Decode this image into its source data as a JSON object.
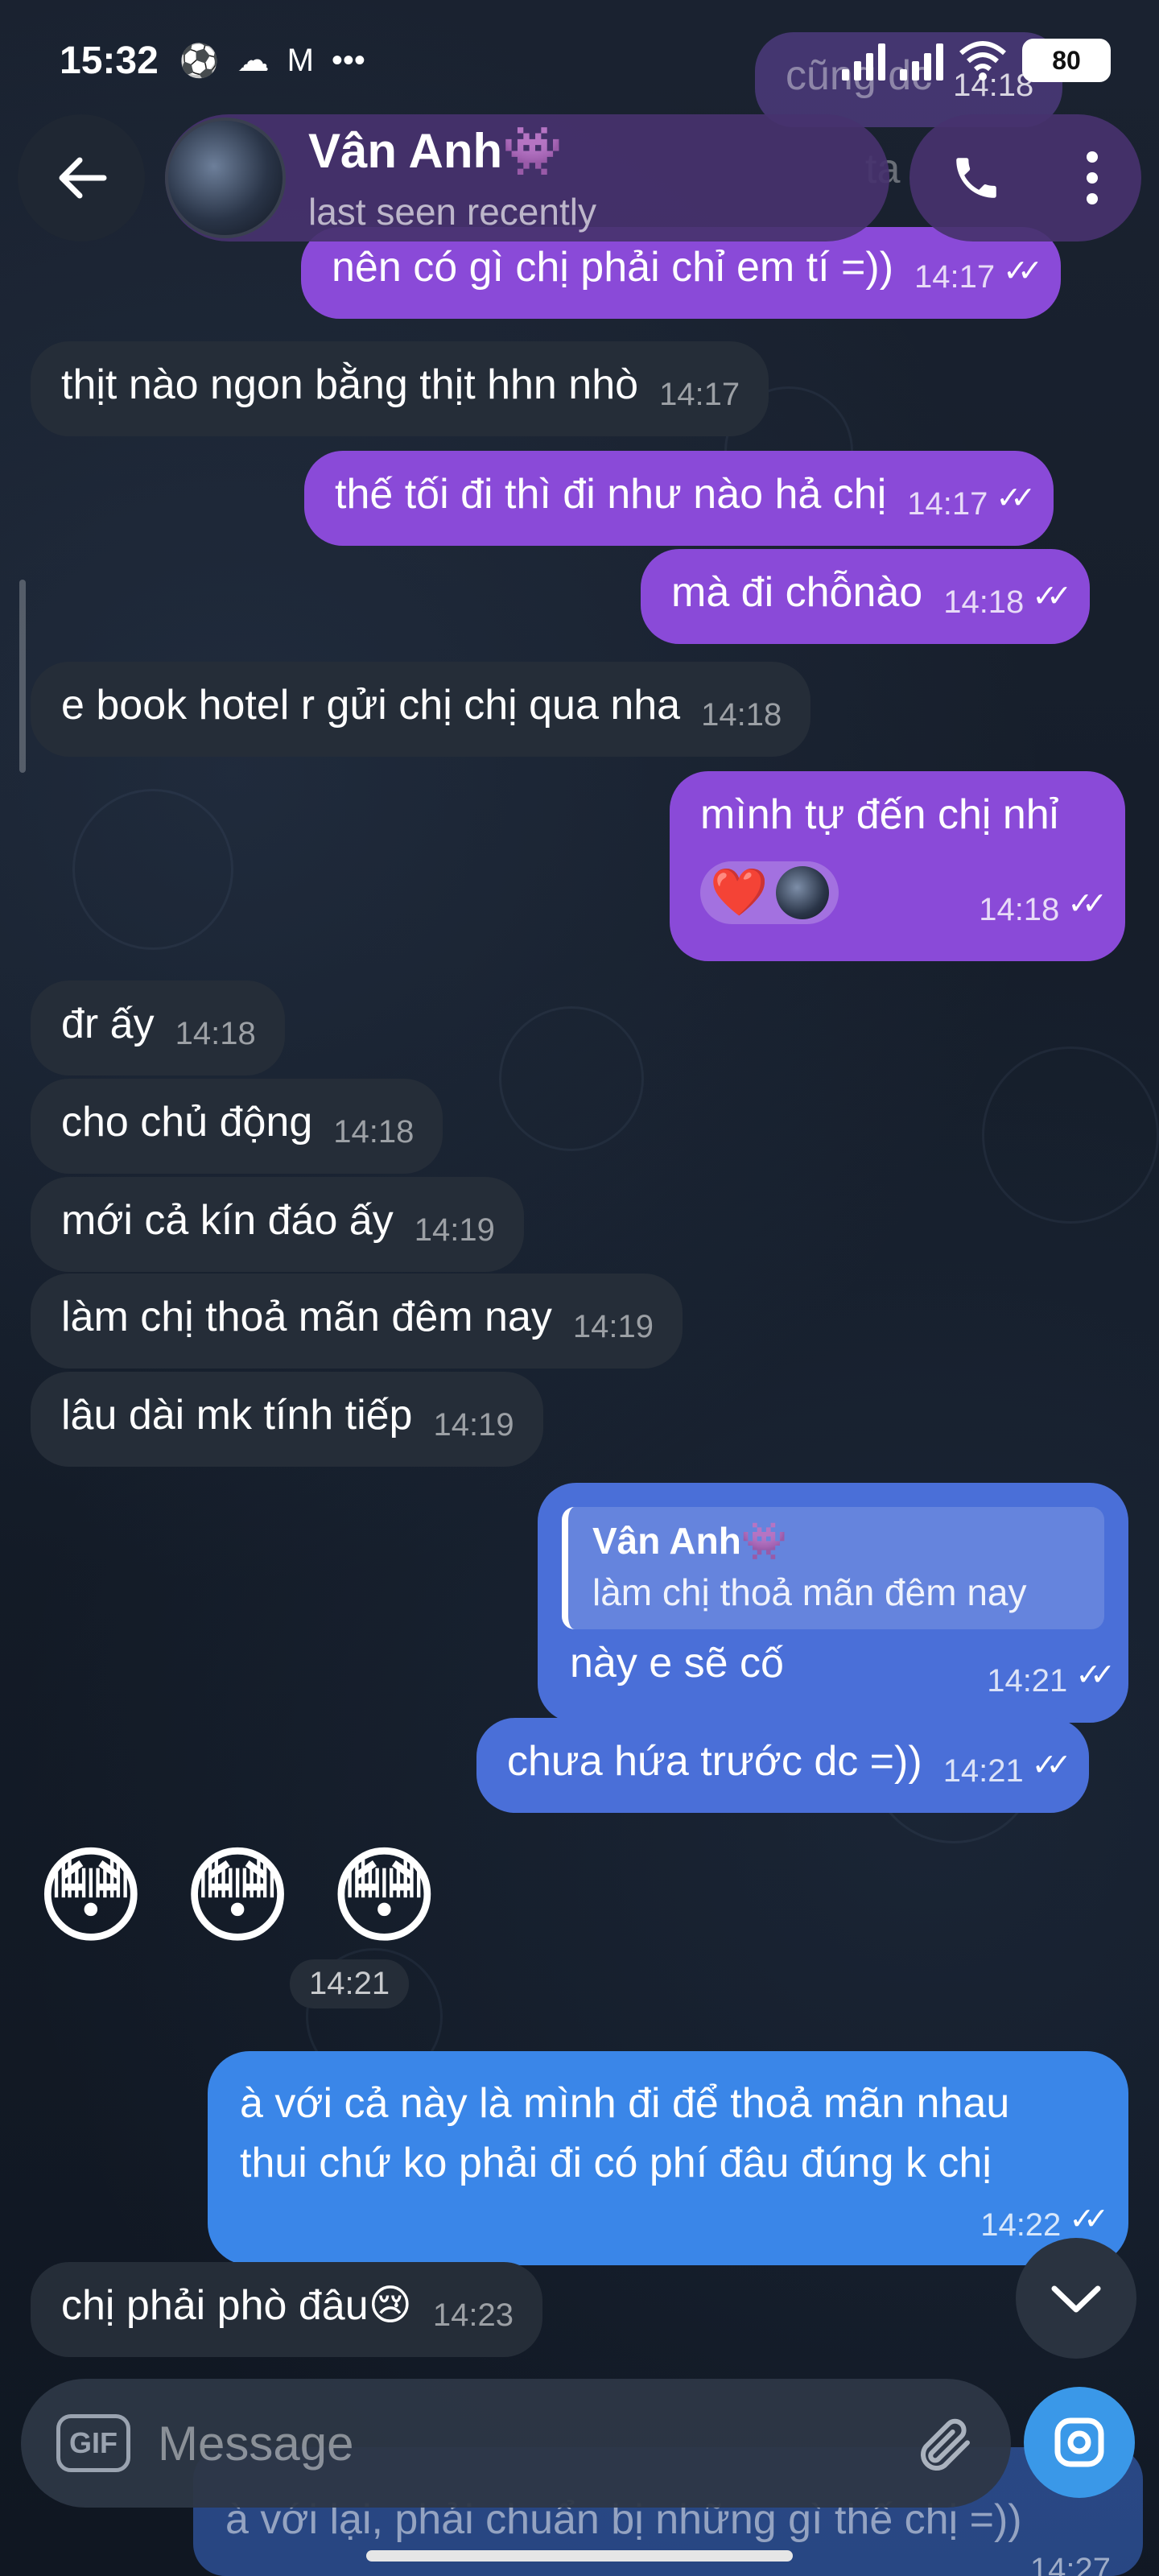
{
  "status_bar": {
    "time": "15:32",
    "icons": [
      "soccer-ball-icon",
      "cloud-icon",
      "gmail-icon",
      "more-icon"
    ],
    "overflow": "•••",
    "battery": "80"
  },
  "header": {
    "back_icon": "arrow-left-icon",
    "name": "Vân Anh👾",
    "subtitle": "last seen recently",
    "call_icon": "phone-icon",
    "menu_icon": "kebab-menu-icon"
  },
  "messages": [
    {
      "dir": "out",
      "text": "nên có gì chị phải chỉ em tí =))",
      "time": "14:17"
    },
    {
      "dir": "in",
      "text": "thịt nào ngon bằng thịt hhn nhò",
      "time": "14:17"
    },
    {
      "dir": "out",
      "text": "thế tối đi thì đi như nào hả chị",
      "time": "14:17"
    },
    {
      "dir": "out",
      "text": "mà đi chỗnào",
      "time": "14:18"
    },
    {
      "dir": "in",
      "text": "e book hotel r gửi chị chị qua nha",
      "time": "14:18"
    },
    {
      "dir": "out",
      "text": "mình tự đến chị nhỉ",
      "time": "14:18",
      "reaction": "❤️"
    },
    {
      "dir": "in",
      "text": "đr ấy",
      "time": "14:18"
    },
    {
      "dir": "in",
      "text": "cho chủ động",
      "time": "14:18"
    },
    {
      "dir": "in",
      "text": "mới cả kín đáo ấy",
      "time": "14:19"
    },
    {
      "dir": "in",
      "text": "làm chị thoả mãn đêm nay",
      "time": "14:19"
    },
    {
      "dir": "in",
      "text": "lâu dài mk tính tiếp",
      "time": "14:19"
    },
    {
      "dir": "out",
      "reply_author": "Vân Anh👾",
      "reply_text": "làm chị thoả mãn đêm nay",
      "text": "này e sẽ cố",
      "time": "14:21"
    },
    {
      "dir": "out",
      "text": "chưa hứa trước dc =))",
      "time": "14:21"
    },
    {
      "dir": "in",
      "emoji": "😳 😳 😳",
      "time": "14:21"
    },
    {
      "dir": "out",
      "text_line1": "à với cả này là mình đi để thoả mãn nhau",
      "text_line2": "thui chứ ko phải đi có phí đâu đúng k chị",
      "time": "14:22"
    },
    {
      "dir": "in",
      "text": "chị phải phò đâu😢",
      "time": "14:23"
    }
  ],
  "ghost_top": {
    "text": "cũng dc",
    "time": "14:18"
  },
  "ghost_reply_peek": "ta",
  "composer": {
    "gif_label": "GIF",
    "placeholder": "Message",
    "attach_icon": "paperclip-icon",
    "camera_icon": "camera-icon",
    "scroll_down_icon": "chevron-down-icon"
  },
  "peek_message": {
    "text": "à với lại, phải chuẩn bị những gì thế chị =))",
    "time": "14:27"
  }
}
